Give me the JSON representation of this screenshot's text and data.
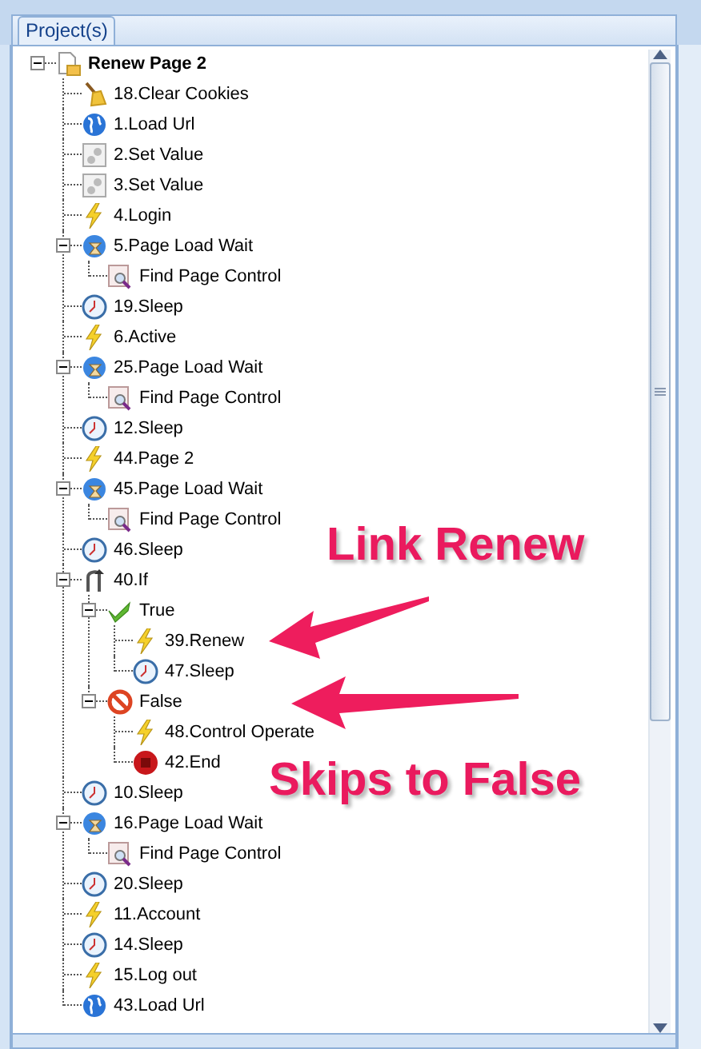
{
  "panel": {
    "tab": "Project(s)"
  },
  "tree": [
    {
      "label": "Renew Page 2",
      "kind": "page",
      "expanded": true,
      "children": [
        {
          "label": "18.Clear Cookies",
          "kind": "broom"
        },
        {
          "label": "1.Load Url",
          "kind": "globe"
        },
        {
          "label": "2.Set Value",
          "kind": "gear"
        },
        {
          "label": "3.Set Value",
          "kind": "gear"
        },
        {
          "label": "4.Login",
          "kind": "bolt"
        },
        {
          "label": "5.Page Load Wait",
          "kind": "wait",
          "expanded": true,
          "children": [
            {
              "label": "Find Page Control",
              "kind": "find"
            }
          ]
        },
        {
          "label": "19.Sleep",
          "kind": "clock"
        },
        {
          "label": "6.Active",
          "kind": "bolt"
        },
        {
          "label": "25.Page Load Wait",
          "kind": "wait",
          "expanded": true,
          "children": [
            {
              "label": "Find Page Control",
              "kind": "find"
            }
          ]
        },
        {
          "label": "12.Sleep",
          "kind": "clock"
        },
        {
          "label": "44.Page 2",
          "kind": "bolt"
        },
        {
          "label": "45.Page Load Wait",
          "kind": "wait",
          "expanded": true,
          "children": [
            {
              "label": "Find Page Control",
              "kind": "find"
            }
          ]
        },
        {
          "label": "46.Sleep",
          "kind": "clock"
        },
        {
          "label": "40.If",
          "kind": "branch",
          "expanded": true,
          "children": [
            {
              "label": "True",
              "kind": "check",
              "expanded": true,
              "children": [
                {
                  "label": "39.Renew",
                  "kind": "bolt"
                },
                {
                  "label": "47.Sleep",
                  "kind": "clock"
                }
              ]
            },
            {
              "label": "False",
              "kind": "forbidden",
              "expanded": true,
              "children": [
                {
                  "label": "48.Control Operate",
                  "kind": "bolt"
                },
                {
                  "label": "42.End",
                  "kind": "stop"
                }
              ]
            }
          ]
        },
        {
          "label": "10.Sleep",
          "kind": "clock"
        },
        {
          "label": "16.Page Load Wait",
          "kind": "wait",
          "expanded": true,
          "children": [
            {
              "label": "Find Page Control",
              "kind": "find"
            }
          ]
        },
        {
          "label": "20.Sleep",
          "kind": "clock"
        },
        {
          "label": "11.Account",
          "kind": "bolt"
        },
        {
          "label": "14.Sleep",
          "kind": "clock"
        },
        {
          "label": "15.Log out",
          "kind": "bolt"
        },
        {
          "label": "43.Load Url",
          "kind": "globe"
        }
      ]
    }
  ],
  "annotations": [
    {
      "text": "Link Renew"
    },
    {
      "text": "Skips to False"
    }
  ]
}
